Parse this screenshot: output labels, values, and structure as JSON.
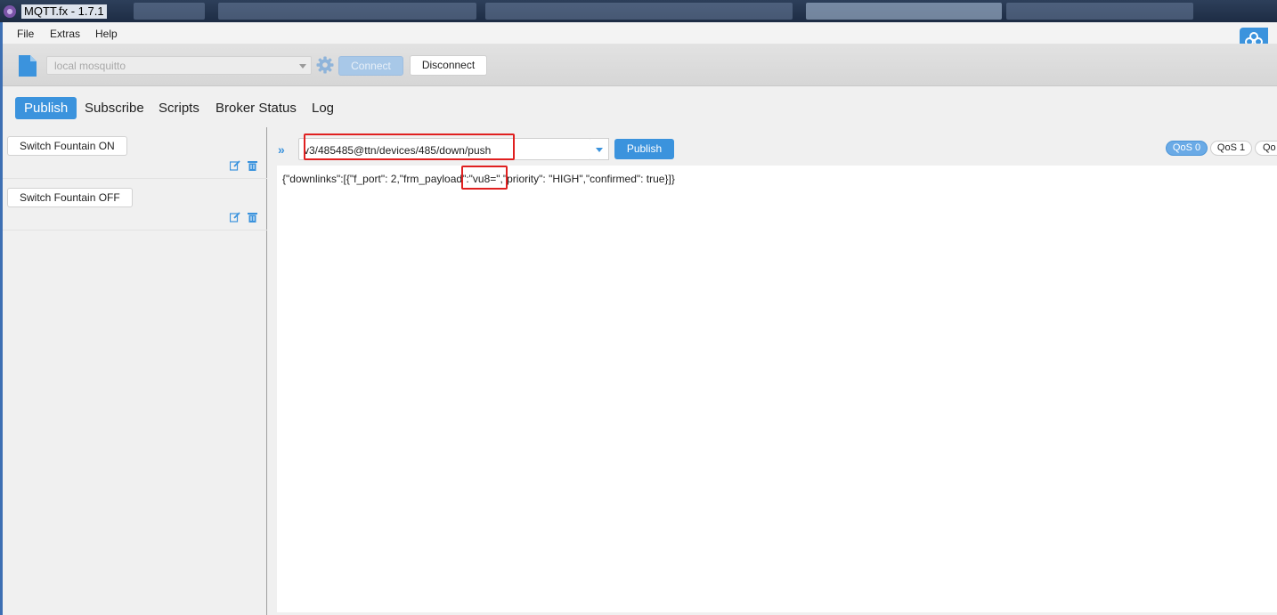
{
  "window": {
    "title": "MQTT.fx - 1.7.1"
  },
  "menu": {
    "items": [
      "File",
      "Extras",
      "Help"
    ]
  },
  "toolbar": {
    "profile": "local mosquitto",
    "connect_label": "Connect",
    "disconnect_label": "Disconnect"
  },
  "tabs": [
    {
      "label": "Publish",
      "active": true
    },
    {
      "label": "Subscribe",
      "active": false
    },
    {
      "label": "Scripts",
      "active": false
    },
    {
      "label": "Broker Status",
      "active": false
    },
    {
      "label": "Log",
      "active": false
    }
  ],
  "scripts": [
    {
      "label": "Switch Fountain ON"
    },
    {
      "label": "Switch Fountain OFF"
    }
  ],
  "publish": {
    "topic": "v3/485485@ttn/devices/485/down/push",
    "button_label": "Publish",
    "qos": [
      "QoS 0",
      "QoS 1",
      "Qo"
    ],
    "payload": "{\"downlinks\":[{\"f_port\": 2,\"frm_payload\":\"vu8=\",\"priority\": \"HIGH\",\"confirmed\": true}]}"
  },
  "colors": {
    "accent": "#3b93dd",
    "highlight": "#e02020"
  }
}
